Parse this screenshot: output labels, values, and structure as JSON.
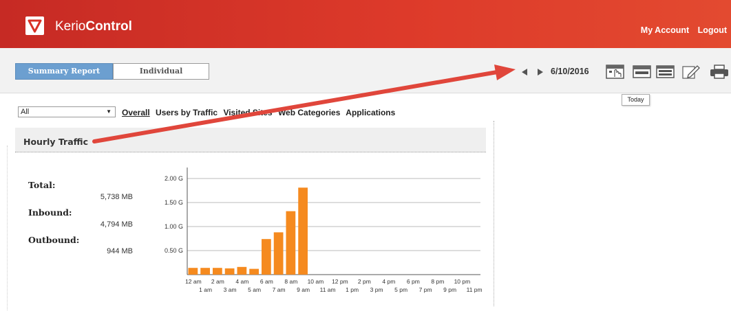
{
  "app": {
    "brand_light": "Kerio",
    "brand_bold": "Control"
  },
  "header": {
    "my_account": "My Account",
    "logout": "Logout"
  },
  "tabs": {
    "summary": "Summary Report",
    "individual": "Individual"
  },
  "date_nav": {
    "date": "6/10/2016",
    "tooltip": "Today"
  },
  "toolbar_icons": [
    "calendar-day-icon",
    "calendar-week-icon",
    "calendar-month-icon",
    "edit-icon",
    "print-icon"
  ],
  "filter": {
    "select_value": "All",
    "links": [
      "Overall",
      "Users by Traffic",
      "Visited Sites",
      "Web Categories",
      "Applications"
    ]
  },
  "panel": {
    "title": "Hourly Traffic"
  },
  "stats": {
    "total_label": "Total:",
    "total_value": "5,738 MB",
    "inbound_label": "Inbound:",
    "inbound_value": "4,794 MB",
    "outbound_label": "Outbound:",
    "outbound_value": "944 MB"
  },
  "colors": {
    "header": "#d83226",
    "accent_tab": "#6c9fd0",
    "bar": "#f58a1f",
    "arrow": "#e0463b"
  },
  "chart_data": {
    "type": "bar",
    "categories": [
      "12 am",
      "1 am",
      "2 am",
      "3 am",
      "4 am",
      "5 am",
      "6 am",
      "7 am",
      "8 am",
      "9 am",
      "10 am",
      "11 am",
      "12 pm",
      "1 pm",
      "2 pm",
      "3 pm",
      "4 pm",
      "5 pm",
      "6 pm",
      "7 pm",
      "8 pm",
      "9 pm",
      "10 pm",
      "11 pm"
    ],
    "values": [
      0.14,
      0.14,
      0.14,
      0.13,
      0.16,
      0.12,
      0.74,
      0.88,
      1.32,
      1.81,
      0,
      0,
      0,
      0,
      0,
      0,
      0,
      0,
      0,
      0,
      0,
      0,
      0,
      0
    ],
    "ytick_labels": [
      "0.50 G",
      "1.00 G",
      "1.50 G",
      "2.00 G"
    ],
    "yticks": [
      0.5,
      1.0,
      1.5,
      2.0
    ],
    "ylim": [
      0,
      2.2
    ],
    "unit": "G",
    "grid": true
  }
}
